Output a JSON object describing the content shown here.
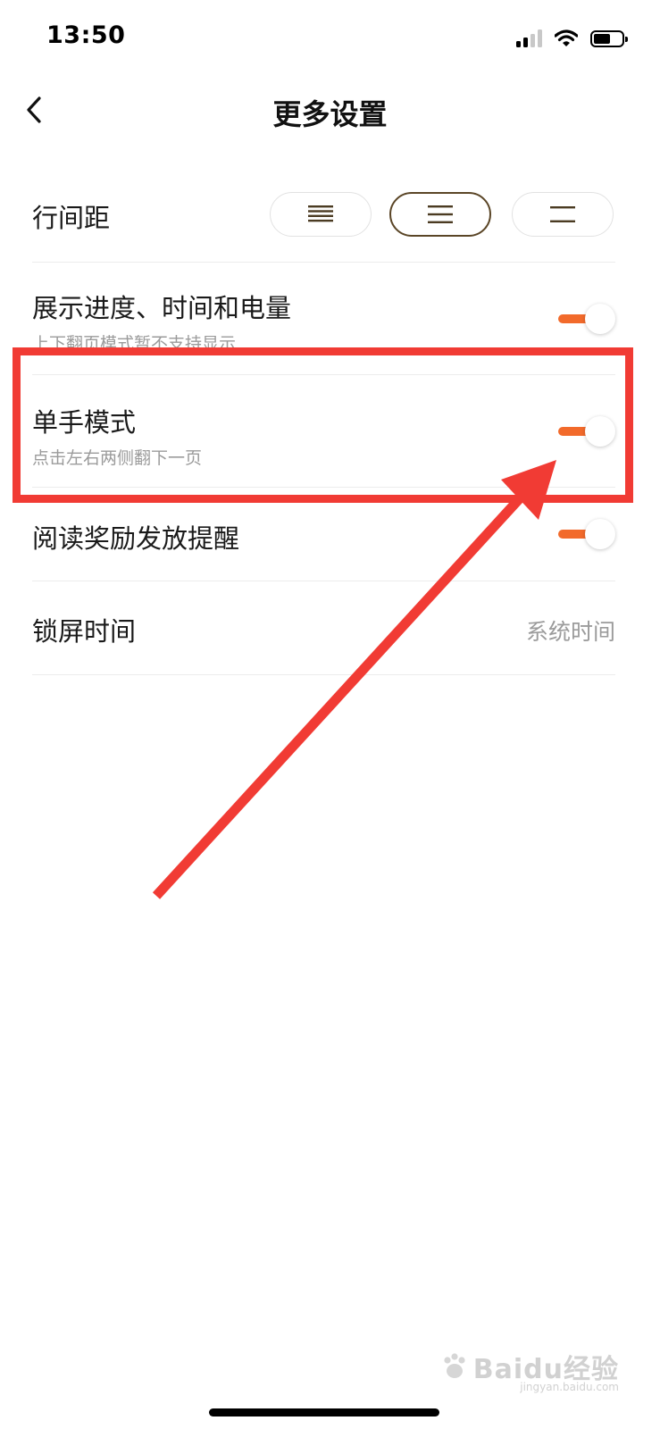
{
  "status_bar": {
    "time": "13:50",
    "icons": [
      "cellular-signal-icon",
      "wifi-icon",
      "battery-icon"
    ]
  },
  "nav": {
    "title": "更多设置",
    "back_icon": "chevron-left-icon"
  },
  "settings": {
    "line_spacing": {
      "label": "行间距",
      "options": [
        "dense-spacing-icon",
        "medium-spacing-icon",
        "wide-spacing-icon"
      ],
      "selected_index": 1
    },
    "show_progress": {
      "label": "展示进度、时间和电量",
      "subtitle": "上下翻页模式暂不支持显示",
      "enabled": true
    },
    "one_hand_mode": {
      "label": "单手模式",
      "subtitle": "点击左右两侧翻下一页",
      "enabled": true
    },
    "reading_reward_reminder": {
      "label": "阅读奖励发放提醒",
      "enabled": true
    },
    "lock_screen_time": {
      "label": "锁屏时间",
      "value": "系统时间"
    }
  },
  "watermark": {
    "brand": "Baidu经验",
    "sub": "jingyan.baidu.com"
  },
  "colors": {
    "accent": "#f26a2b",
    "selected_border": "#5a4526",
    "annotation_red": "#f13b34",
    "secondary_text": "#9b9b9b",
    "divider": "#ececec"
  }
}
